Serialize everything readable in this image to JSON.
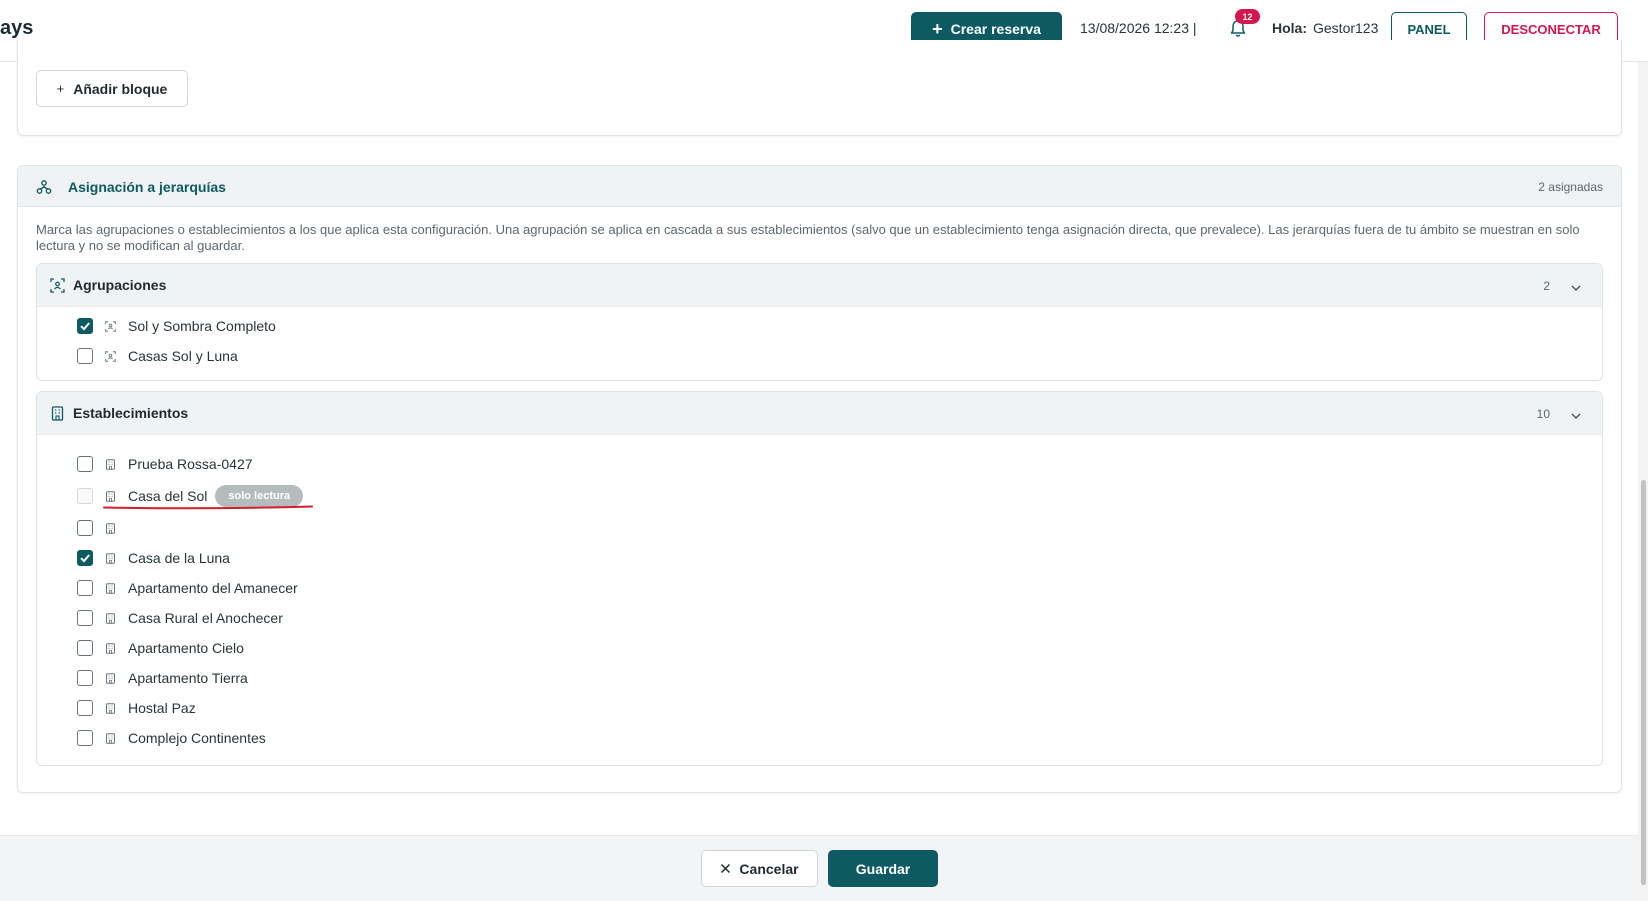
{
  "header": {
    "brand_partial": "ays",
    "create_button": "Crear reserva",
    "datetime": "13/08/2026 12:23 |",
    "notifications_count": "12",
    "greeting_label": "Hola:",
    "username": "Gestor123",
    "panel_button": "PANEL",
    "logout_button": "DESCONECTAR"
  },
  "blocks": {
    "add_block_button": "Añadir bloque"
  },
  "hierarchy": {
    "title": "Asignación a jerarquías",
    "assigned_count": "2 asignadas",
    "description": "Marca las agrupaciones o establecimientos a los que aplica esta configuración. Una agrupación se aplica en cascada a sus establecimientos (salvo que un establecimiento tenga asignación directa, que prevalece). Las jerarquías fuera de tu ámbito se muestran en solo lectura y no se modifican al guardar.",
    "groups": {
      "title": "Agrupaciones",
      "count": "2",
      "items": [
        {
          "label": "Sol y Sombra Completo",
          "checked": true
        },
        {
          "label": "Casas Sol y Luna",
          "checked": false
        }
      ]
    },
    "establishments": {
      "title": "Establecimientos",
      "count": "10",
      "items": [
        {
          "label": "Prueba Rossa-0427",
          "checked": false
        },
        {
          "label": "Casa del Sol",
          "checked": false,
          "readonly": true,
          "badge": "solo lectura"
        },
        {
          "label": "",
          "checked": false
        },
        {
          "label": "Casa de la Luna",
          "checked": true
        },
        {
          "label": "Apartamento del Amanecer",
          "checked": false
        },
        {
          "label": "Casa Rural el Anochecer",
          "checked": false
        },
        {
          "label": "Apartamento Cielo",
          "checked": false
        },
        {
          "label": "Apartamento Tierra",
          "checked": false
        },
        {
          "label": "Hostal Paz",
          "checked": false
        },
        {
          "label": "Complejo Continentes",
          "checked": false
        }
      ]
    }
  },
  "footer": {
    "cancel_button": "Cancelar",
    "save_button": "Guardar"
  },
  "colors": {
    "primary": "#0e5a62",
    "danger": "#d6174f",
    "annotation": "#d11f2b"
  },
  "icons": [
    "plus-icon",
    "bell-icon",
    "hierarchy-icon",
    "group-icon",
    "building-icon",
    "chevron-down-icon",
    "close-icon",
    "checkmark-icon"
  ]
}
